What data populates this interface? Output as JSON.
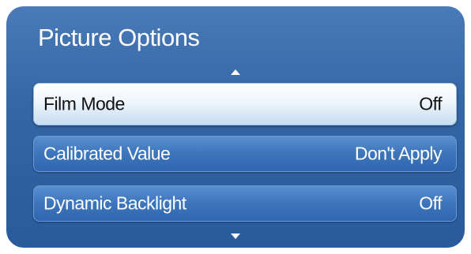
{
  "menu": {
    "title": "Picture Options",
    "items": [
      {
        "label": "Film Mode",
        "value": "Off",
        "selected": true
      },
      {
        "label": "Calibrated Value",
        "value": "Don't Apply",
        "selected": false
      },
      {
        "label": "Dynamic Backlight",
        "value": "Off",
        "selected": false
      }
    ],
    "scroll_up_icon": "triangle-up-icon",
    "scroll_down_icon": "triangle-down-icon"
  },
  "colors": {
    "panel_top": "#4a7bb8",
    "panel_bottom": "#285a9c",
    "selected_item": "#ffffff",
    "item": "#3f77bd",
    "text_light": "#ffffff",
    "text_dark": "#111111"
  }
}
